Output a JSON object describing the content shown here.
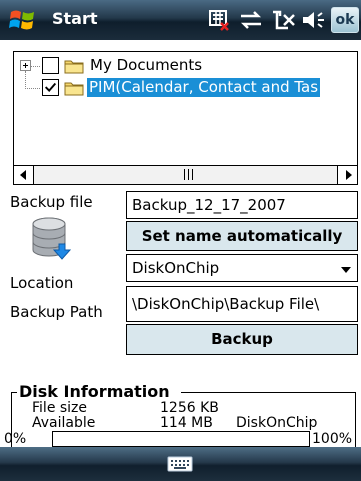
{
  "titlebar": {
    "title": "Start",
    "ok_label": "ok",
    "icons": [
      "windows-flag-icon",
      "memory-card-icon",
      "connectivity-icon",
      "phone-antenna-icon",
      "volume-icon"
    ]
  },
  "tree": {
    "items": [
      {
        "label": "My Documents",
        "checked": false,
        "expandable": true
      },
      {
        "label": "PIM(Calendar, Contact and Tas",
        "checked": true,
        "selected": true
      }
    ],
    "scroll_thumb": "III"
  },
  "form": {
    "backup_file_label": "Backup file",
    "backup_file_value": "Backup_12_17_2007",
    "set_name_button": "Set name automatically",
    "location_label": "Location",
    "location_value": "DiskOnChip",
    "backup_path_label": "Backup Path",
    "backup_path_value": "\\DiskOnChip\\Backup File\\",
    "backup_button": "Backup"
  },
  "disk_info": {
    "title": "Disk Information",
    "file_size_label": "File size",
    "file_size_value": "1256 KB",
    "available_label": "Available",
    "available_value": "114 MB",
    "available_location": "DiskOnChip"
  },
  "progress": {
    "min_label": "0%",
    "max_label": "100%",
    "value": 0
  },
  "colors": {
    "selection": "#1a8fd6",
    "button_fill": "#d9e7ed"
  }
}
